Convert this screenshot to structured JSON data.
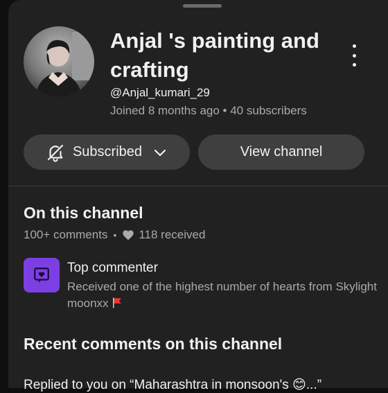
{
  "channel": {
    "name": "Anjal 's painting and crafting",
    "handle": "@Anjal_kumari_29",
    "meta": "Joined 8 months ago • 40 subscribers"
  },
  "actions": {
    "subscribed_label": "Subscribed",
    "view_channel_label": "View channel"
  },
  "on_channel": {
    "title": "On this channel",
    "comments": "100+ comments",
    "separator": "•",
    "hearts": "118 received"
  },
  "badge": {
    "title": "Top commenter",
    "description": "Received one of the highest number of hearts from Skylight moonxx",
    "icon": "heart-chat-icon",
    "color": "#7b3fe4"
  },
  "recent": {
    "title": "Recent comments on this channel",
    "replied_text": "Replied to you on “Maharashtra in monsoon's 😊...”"
  }
}
